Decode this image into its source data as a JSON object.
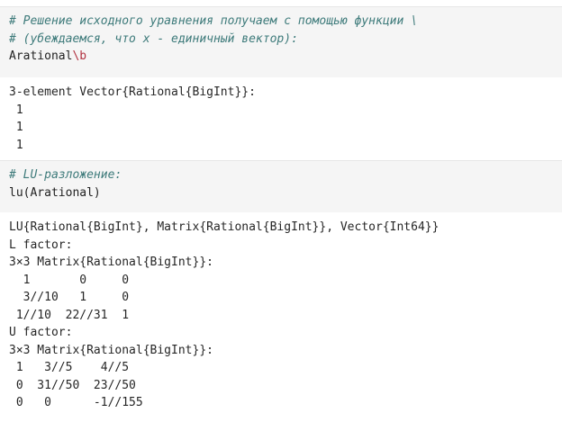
{
  "cell1": {
    "comment_line1": "# Решение исходного уравнения получаем с помощью функции \\",
    "comment_line2": "# (убеждаемся, что x - единичный вектор):",
    "code_prefix": "Arational",
    "code_escape": "\\b"
  },
  "output1": {
    "header": "3-element Vector{Rational{BigInt}}:",
    "values": [
      " 1",
      " 1",
      " 1"
    ]
  },
  "cell2": {
    "comment_line1": "# LU-разложение:",
    "code": "lu(Arational)"
  },
  "output2": {
    "header": "LU{Rational{BigInt}, Matrix{Rational{BigInt}}, Vector{Int64}}",
    "l_label": "L factor:",
    "l_type": "3×3 Matrix{Rational{BigInt}}:",
    "l_rows": [
      "  1       0     0",
      "  3//10   1     0",
      " 1//10  22//31  1"
    ],
    "u_label": "U factor:",
    "u_type": "3×3 Matrix{Rational{BigInt}}:",
    "u_rows": [
      " 1   3//5    4//5",
      " 0  31//50  23//50",
      " 0   0      -1//155"
    ]
  }
}
